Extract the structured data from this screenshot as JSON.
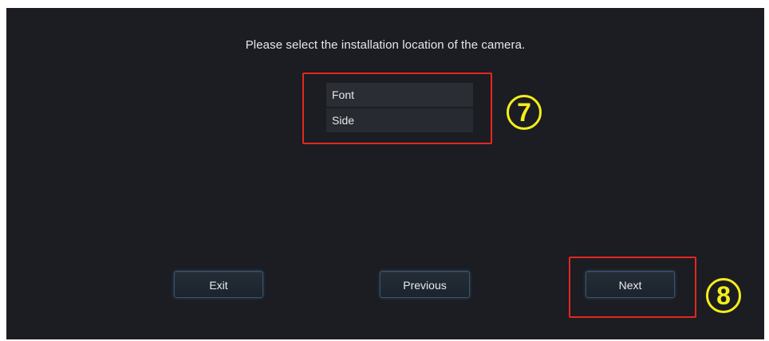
{
  "wizard": {
    "prompt": "Please select the installation location of the camera.",
    "locations": [
      {
        "label": "Font"
      },
      {
        "label": "Side"
      }
    ]
  },
  "annotations": {
    "callout_list": "7",
    "callout_next": "8",
    "highlight_color": "#e5261f",
    "callout_color": "#f5ee1a"
  },
  "buttons": {
    "exit_label": "Exit",
    "previous_label": "Previous",
    "next_label": "Next"
  }
}
